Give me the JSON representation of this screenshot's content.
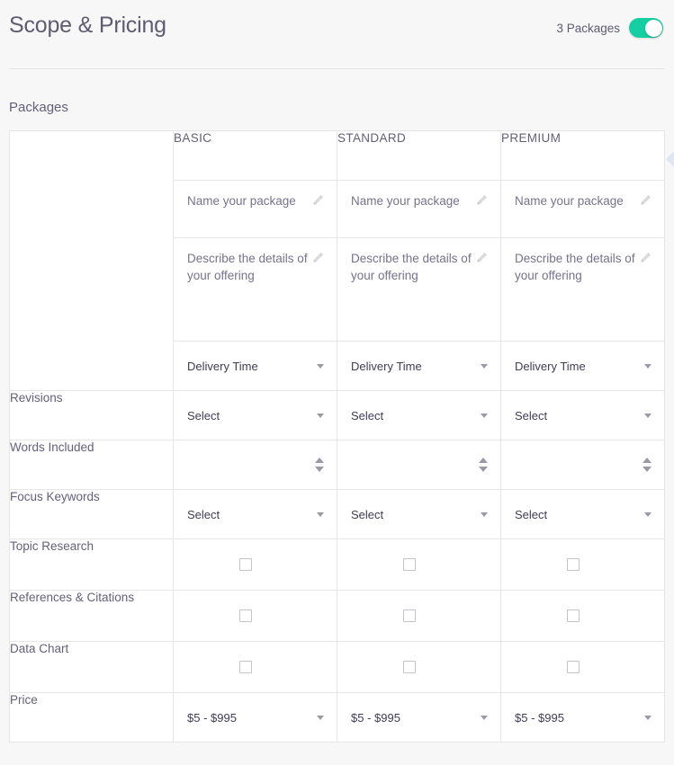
{
  "header": {
    "title": "Scope & Pricing",
    "packages_count_label": "3 Packages",
    "toggle": {
      "name": "packages-toggle",
      "state": "on",
      "color": "#15cfa3"
    }
  },
  "section": {
    "label": "Packages"
  },
  "table": {
    "columns": [
      "BASIC",
      "STANDARD",
      "PREMIUM"
    ],
    "rows": [
      {
        "key": "name",
        "label": "",
        "type": "text-edit",
        "values": [
          "Name your package",
          "Name your package",
          "Name your package"
        ],
        "icon": "pencil-icon"
      },
      {
        "key": "description",
        "label": "",
        "type": "textarea-edit",
        "values": [
          "Describe the details of your offering",
          "Describe the details of your offering",
          "Describe the details of your offering"
        ],
        "icon": "pencil-icon"
      },
      {
        "key": "delivery_time",
        "label": "",
        "type": "select",
        "values": [
          "Delivery Time",
          "Delivery Time",
          "Delivery Time"
        ]
      },
      {
        "key": "revisions",
        "label": "Revisions",
        "type": "select",
        "values": [
          "Select",
          "Select",
          "Select"
        ]
      },
      {
        "key": "words_included",
        "label": "Words Included",
        "type": "number-spinner",
        "values": [
          "",
          "",
          ""
        ]
      },
      {
        "key": "focus_keywords",
        "label": "Focus Keywords",
        "type": "select",
        "values": [
          "Select",
          "Select",
          "Select"
        ]
      },
      {
        "key": "topic_research",
        "label": "Topic Research",
        "type": "checkbox",
        "values": [
          false,
          false,
          false
        ]
      },
      {
        "key": "references_citations",
        "label": "References & Citations",
        "type": "checkbox",
        "values": [
          false,
          false,
          false
        ]
      },
      {
        "key": "data_chart",
        "label": "Data Chart",
        "type": "checkbox",
        "values": [
          false,
          false,
          false
        ]
      },
      {
        "key": "price",
        "label": "Price",
        "type": "select",
        "values": [
          "$5 - $995",
          "$5 - $995",
          "$5 - $995"
        ]
      }
    ]
  },
  "edge_handle": {
    "name": "panel-collapse-handle",
    "color": "#dfe5f2"
  }
}
